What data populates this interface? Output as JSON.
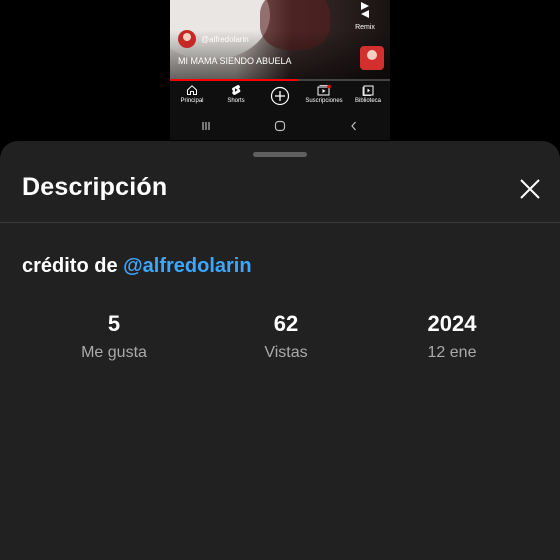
{
  "background_app": {
    "video": {
      "channel_handle": "@alfredolarin",
      "title": "MI MAMA SIENDO ABUELA",
      "remix_label": "Remix",
      "progress_fraction": 0.58
    },
    "nav": [
      {
        "label": "Principal",
        "icon": "home-icon"
      },
      {
        "label": "Shorts",
        "icon": "shorts-icon"
      },
      {
        "label": "",
        "icon": "create-icon"
      },
      {
        "label": "Suscripciones",
        "icon": "subscriptions-icon"
      },
      {
        "label": "Biblioteca",
        "icon": "library-icon"
      }
    ],
    "system_nav": [
      "recent-apps-icon",
      "home-circle-icon",
      "back-icon"
    ]
  },
  "sheet": {
    "title": "Descripción",
    "credit_prefix": "crédito de ",
    "credit_mention": "@alfredolarin",
    "stats": [
      {
        "value": "5",
        "caption": "Me gusta"
      },
      {
        "value": "62",
        "caption": "Vistas"
      },
      {
        "value": "2024",
        "caption": "12 ene"
      }
    ]
  },
  "colors": {
    "sheet_bg": "#212121",
    "mention": "#3ea6ff",
    "progress": "#ff0000"
  }
}
